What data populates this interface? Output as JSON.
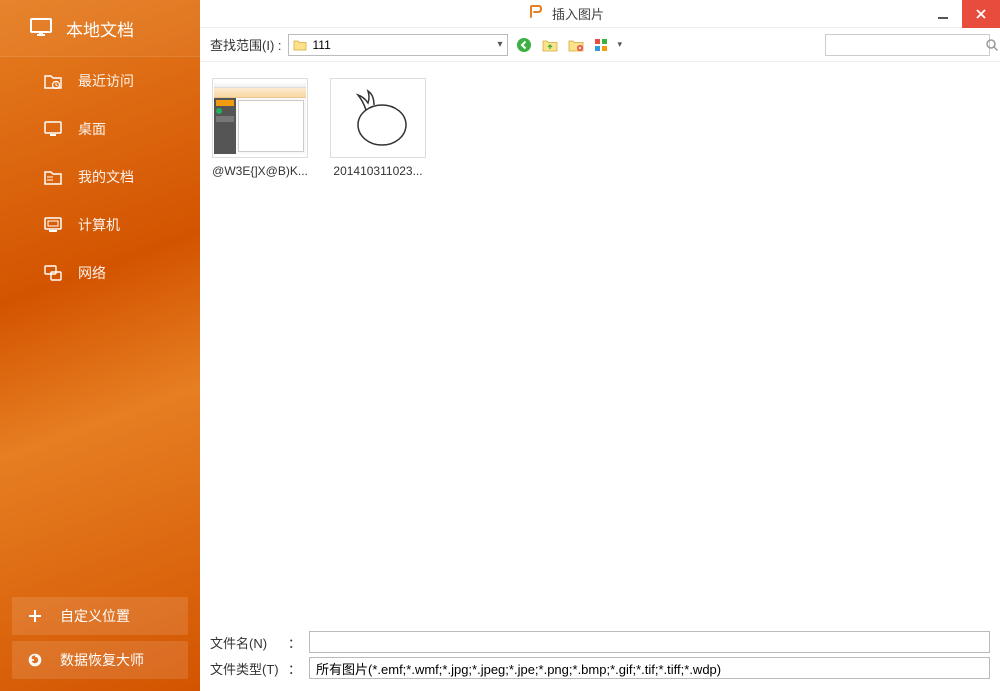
{
  "sidebar": {
    "title": "本地文档",
    "items": [
      {
        "label": "最近访问",
        "icon": "recent"
      },
      {
        "label": "桌面",
        "icon": "desktop"
      },
      {
        "label": "我的文档",
        "icon": "documents"
      },
      {
        "label": "计算机",
        "icon": "computer"
      },
      {
        "label": "网络",
        "icon": "network"
      }
    ],
    "buttons": [
      {
        "label": "自定义位置",
        "icon": "plus"
      },
      {
        "label": "数据恢复大师",
        "icon": "recover"
      }
    ]
  },
  "titlebar": {
    "title": "插入图片"
  },
  "toolbar": {
    "lookin_label": "查找范围(I)",
    "current_folder": "111"
  },
  "search": {
    "placeholder": ""
  },
  "files": [
    {
      "name": "@W3E{]X@B)K...",
      "kind": "screenshot"
    },
    {
      "name": "201410311023...",
      "kind": "eggplant"
    }
  ],
  "footer": {
    "filename_label": "文件名(N)",
    "filetype_label": "文件类型(T)",
    "filename_value": "",
    "filetype_value": "所有图片(*.emf;*.wmf;*.jpg;*.jpeg;*.jpe;*.png;*.bmp;*.gif;*.tif;*.tiff;*.wdp)"
  },
  "colors": {
    "accent": "#e67e22",
    "close": "#e74c3c"
  }
}
